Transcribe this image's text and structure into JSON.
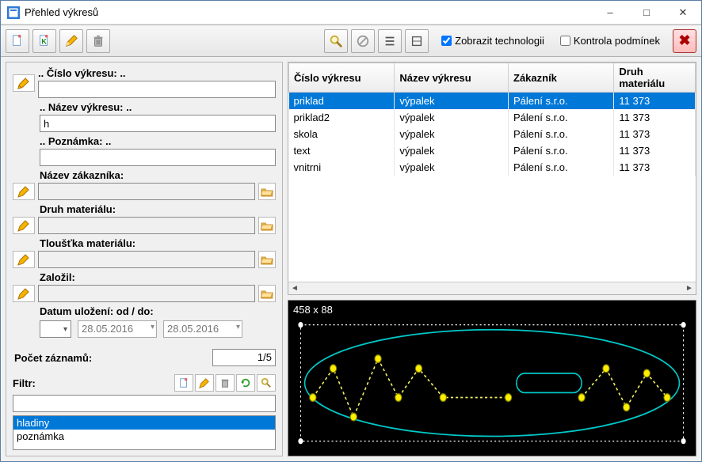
{
  "window": {
    "title": "Přehled výkresů"
  },
  "toolbar": {
    "show_tech_label": "Zobrazit technologii",
    "show_tech_checked": true,
    "cond_check_label": "Kontrola podmínek",
    "cond_check_checked": false
  },
  "filters": {
    "cislo_label": ".. Číslo výkresu: ..",
    "cislo_value": "",
    "nazev_label": ".. Název výkresu: ..",
    "nazev_value": "h",
    "poznamka_label": ".. Poznámka: ..",
    "poznamka_value": "",
    "zakaznik_label": "Název zákazníka:",
    "zakaznik_value": "",
    "material_label": "Druh materiálu:",
    "material_value": "",
    "tloustka_label": "Tloušťka materiálu:",
    "tloustka_value": "",
    "zalozil_label": "Založil:",
    "zalozil_value": "",
    "datum_label": "Datum uložení:  od / do:",
    "date_from": "28.05.2016",
    "date_to": "28.05.2016",
    "count_label": "Počet záznamů:",
    "count_value": "1/5"
  },
  "filterbar": {
    "label": "Filtr:",
    "value": "",
    "items": [
      "hladiny",
      "poznámka"
    ],
    "selected_index": 0
  },
  "grid": {
    "columns": [
      "Číslo výkresu",
      "Název výkresu",
      "Zákazník",
      "Druh materiálu"
    ],
    "rows": [
      {
        "cislo": "priklad",
        "nazev": "výpalek",
        "zakaznik": "Pálení s.r.o.",
        "material": "11 373",
        "selected": true
      },
      {
        "cislo": "priklad2",
        "nazev": "výpalek",
        "zakaznik": "Pálení s.r.o.",
        "material": "11 373",
        "selected": false
      },
      {
        "cislo": "skola",
        "nazev": "výpalek",
        "zakaznik": "Pálení s.r.o.",
        "material": "11 373",
        "selected": false
      },
      {
        "cislo": "text",
        "nazev": "výpalek",
        "zakaznik": "Pálení s.r.o.",
        "material": "11 373",
        "selected": false
      },
      {
        "cislo": "vnitrni",
        "nazev": "výpalek",
        "zakaznik": "Pálení s.r.o.",
        "material": "11 373",
        "selected": false
      }
    ]
  },
  "preview": {
    "dimensions": "458 x 88"
  },
  "icons": {
    "new": "new-doc-icon",
    "new_k": "new-k-doc-icon",
    "edit": "pencil-icon",
    "delete": "trash-icon",
    "search": "magnifier-icon",
    "disable": "no-entry-icon",
    "list": "list-icon",
    "single": "single-row-icon",
    "close": "close-x-icon",
    "folder": "folder-open-icon",
    "refresh": "refresh-icon"
  }
}
